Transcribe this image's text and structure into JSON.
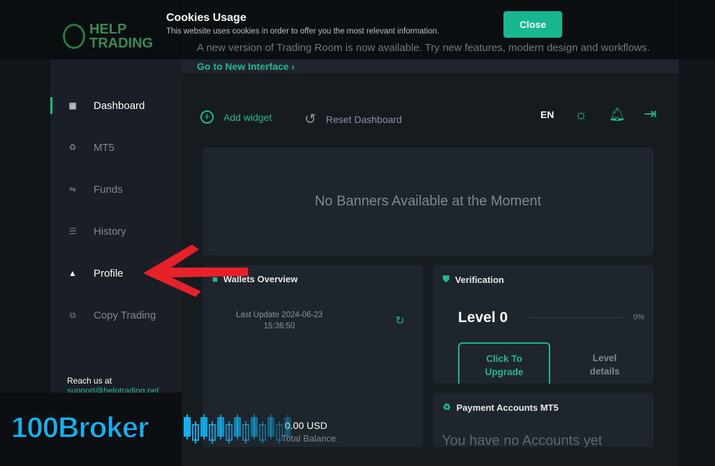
{
  "announcement": {
    "text": "A new version of Trading Room is now available. Try new features, modern design and workflows.",
    "link": "Go to New Interface"
  },
  "logo": {
    "line1": "HELP",
    "line2": "TRADING"
  },
  "cookie": {
    "title": "Cookies Usage",
    "text": "This website uses cookies in order to offer you the most relevant information.",
    "close": "Close"
  },
  "sidebar": {
    "items": [
      {
        "label": "Dashboard",
        "icon": "grid-icon"
      },
      {
        "label": "MT5",
        "icon": "recycle-icon"
      },
      {
        "label": "Funds",
        "icon": "transfer-icon"
      },
      {
        "label": "History",
        "icon": "list-icon"
      },
      {
        "label": "Profile",
        "icon": "user-icon"
      },
      {
        "label": "Copy Trading",
        "icon": "copy-icon"
      }
    ],
    "reach": "Reach us at",
    "email": "support@helptrading.net"
  },
  "toolbar": {
    "add_widget": "Add widget",
    "reset": "Reset Dashboard",
    "lang": "EN"
  },
  "banner": {
    "text": "No Banners Available at the Moment"
  },
  "wallets": {
    "title": "Wallets Overview",
    "last_update": "Last Update 2024-06-23",
    "time": "15:36:50",
    "balance": "0.00 USD",
    "balance_label": "Total Balance"
  },
  "verification": {
    "title": "Verification",
    "level": "Level 0",
    "progress_percent": 0,
    "progress_label": "0%",
    "upgrade": "Click To Upgrade",
    "details": "Level details"
  },
  "payment": {
    "title": "Payment Accounts MT5",
    "empty": "You have no Accounts yet"
  },
  "watermark": {
    "text": "100Broker"
  },
  "colors": {
    "accent": "#1fb98e",
    "annotation_arrow": "#e8202a",
    "watermark": "#0ab4f5"
  }
}
